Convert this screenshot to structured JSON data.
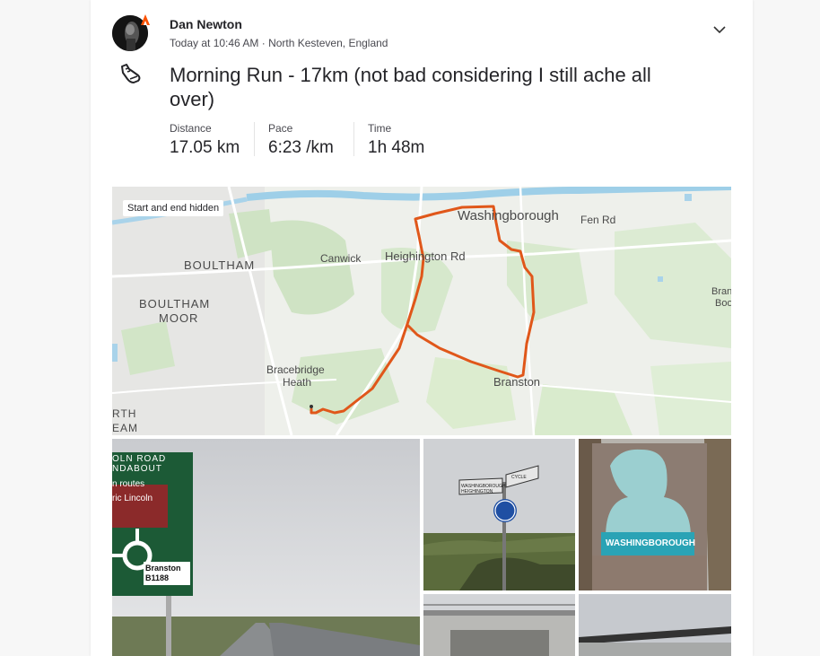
{
  "athlete": {
    "name": "Dan Newton",
    "meta": "Today at 10:46 AM · North Kesteven, England"
  },
  "activity": {
    "title": "Morning Run - 17km (not bad considering I still ache all over)",
    "stats": [
      {
        "label": "Distance",
        "value": "17.05 km"
      },
      {
        "label": "Pace",
        "value": "6:23 /km"
      },
      {
        "label": "Time",
        "value": "1h 48m"
      }
    ]
  },
  "map": {
    "privacy_label": "Start and end hidden",
    "places": {
      "washingborough": "Washingborough",
      "fen_rd": "Fen Rd",
      "heighington_rd": "Heighington Rd",
      "canwick": "Canwick",
      "boultham": "BOULTHAM",
      "boultham_moor_1": "BOULTHAM",
      "boultham_moor_2": "MOOR",
      "bracebridge_1": "Bracebridge",
      "bracebridge_2": "Heath",
      "branston": "Branston",
      "bran_1": "Bran",
      "bran_2": "Boo",
      "north_1": "RTH",
      "north_2": "EAM"
    },
    "route_color": "#e0571a"
  },
  "photos": {
    "sign1": {
      "line1": "OLN ROAD",
      "line2": "NDABOUT",
      "line3": "n routes",
      "line4": "ric Lincoln",
      "line5": "Branston",
      "line6": "B1188"
    },
    "sign2": {
      "left": "WASHINGBOROUGH",
      "left2": "HEIGHINGTON",
      "right": "CYCLE"
    },
    "sign3": {
      "text": "WASHINGBOROUGH"
    }
  },
  "colors": {
    "strava_orange": "#fc5200",
    "text": "#242428",
    "muted": "#494950"
  }
}
